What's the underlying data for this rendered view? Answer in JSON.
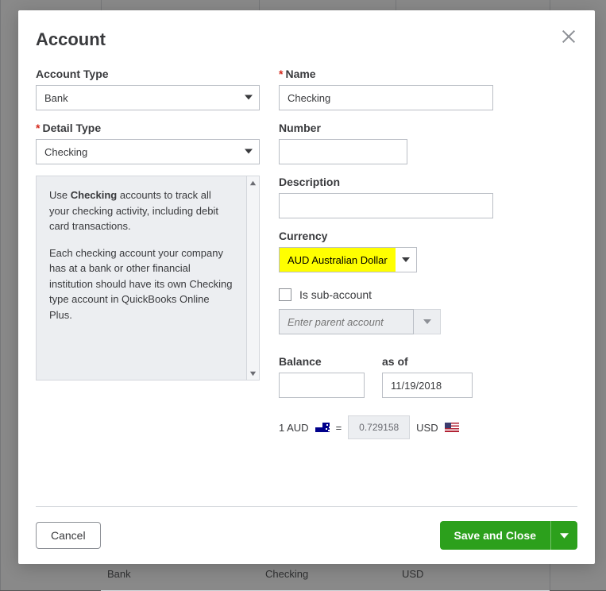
{
  "modal": {
    "title": "Account",
    "close_label": "Close"
  },
  "left": {
    "account_type": {
      "label": "Account Type",
      "value": "Bank"
    },
    "detail_type": {
      "label": "Detail Type",
      "value": "Checking"
    },
    "help": {
      "para1_prefix": "Use ",
      "para1_bold": "Checking",
      "para1_suffix": " accounts to track all your checking activity, including debit card transactions.",
      "para2": "Each checking account your company has at a bank or other financial institution should have its own Checking type account in QuickBooks Online Plus."
    }
  },
  "right": {
    "name": {
      "label": "Name",
      "value": "Checking"
    },
    "number": {
      "label": "Number",
      "value": ""
    },
    "description": {
      "label": "Description",
      "value": ""
    },
    "currency": {
      "label": "Currency",
      "value": "AUD Australian Dollar"
    },
    "sub_account": {
      "label": "Is sub-account",
      "checked": false,
      "parent_placeholder": "Enter parent account"
    },
    "balance": {
      "label": "Balance",
      "value": ""
    },
    "as_of": {
      "label": "as of",
      "value": "11/19/2018"
    },
    "rate": {
      "lhs": "1 AUD",
      "eq": "=",
      "value": "0.729158",
      "rhs_currency": "USD"
    }
  },
  "footer": {
    "cancel": "Cancel",
    "save": "Save and Close"
  },
  "background_table": {
    "cells": {
      "c1": "Bank",
      "c2": "Checking",
      "c3": "USD"
    }
  }
}
